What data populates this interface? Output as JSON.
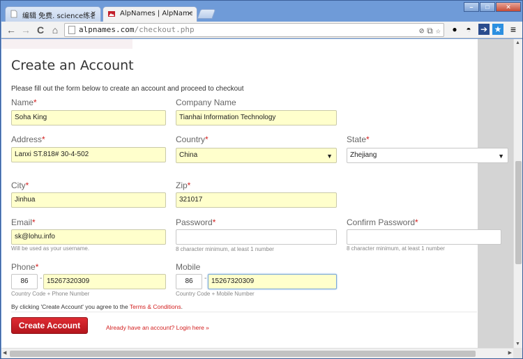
{
  "browser": {
    "tabs": [
      {
        "title": "编辑 免费. science练名 -",
        "close": "×"
      },
      {
        "title": "AlpNames | AlpNames | S",
        "close": "×"
      }
    ],
    "url_domain": "alpnames.com",
    "url_path": "/checkout.php",
    "nav": {
      "back": "←",
      "forward": "→",
      "reload": "C",
      "home": "⌂"
    },
    "menu_icon": "≡"
  },
  "page": {
    "title": "Create an Account",
    "intro": "Please fill out the form below to create an account and proceed to checkout",
    "required_mark": "*",
    "fields": {
      "name": {
        "label": "Name",
        "value": "Soha King"
      },
      "company": {
        "label": "Company Name",
        "value": "Tianhai Information Technology"
      },
      "address": {
        "label": "Address",
        "value": "Lanxi ST.818# 30-4-502"
      },
      "country": {
        "label": "Country",
        "value": "China"
      },
      "state": {
        "label": "State",
        "value": "Zhejiang"
      },
      "city": {
        "label": "City",
        "value": "Jinhua"
      },
      "zip": {
        "label": "Zip",
        "value": "321017"
      },
      "email": {
        "label": "Email",
        "value": "sk@lohu.info",
        "hint": "Will be used as your username."
      },
      "password": {
        "label": "Password",
        "value": "",
        "hint": "8 character minimum, at least 1 number"
      },
      "confirm_password": {
        "label": "Confirm Password",
        "value": "",
        "hint": "8 character minimum, at least 1 number"
      },
      "phone": {
        "label": "Phone",
        "code": "86",
        "number": "15267320309",
        "hint": "Country Code + Phone Number"
      },
      "mobile": {
        "label": "Mobile",
        "code": "86",
        "number": "15267320309",
        "hint": "Country Code + Mobile Number"
      }
    },
    "phone_dash": "-",
    "agree_prefix": "By clicking 'Create Account' you agree to the ",
    "agree_link": "Terms & Conditions",
    "agree_suffix": ".",
    "create_button": "Create Account",
    "login_link": "Already have an account? Login here »"
  }
}
